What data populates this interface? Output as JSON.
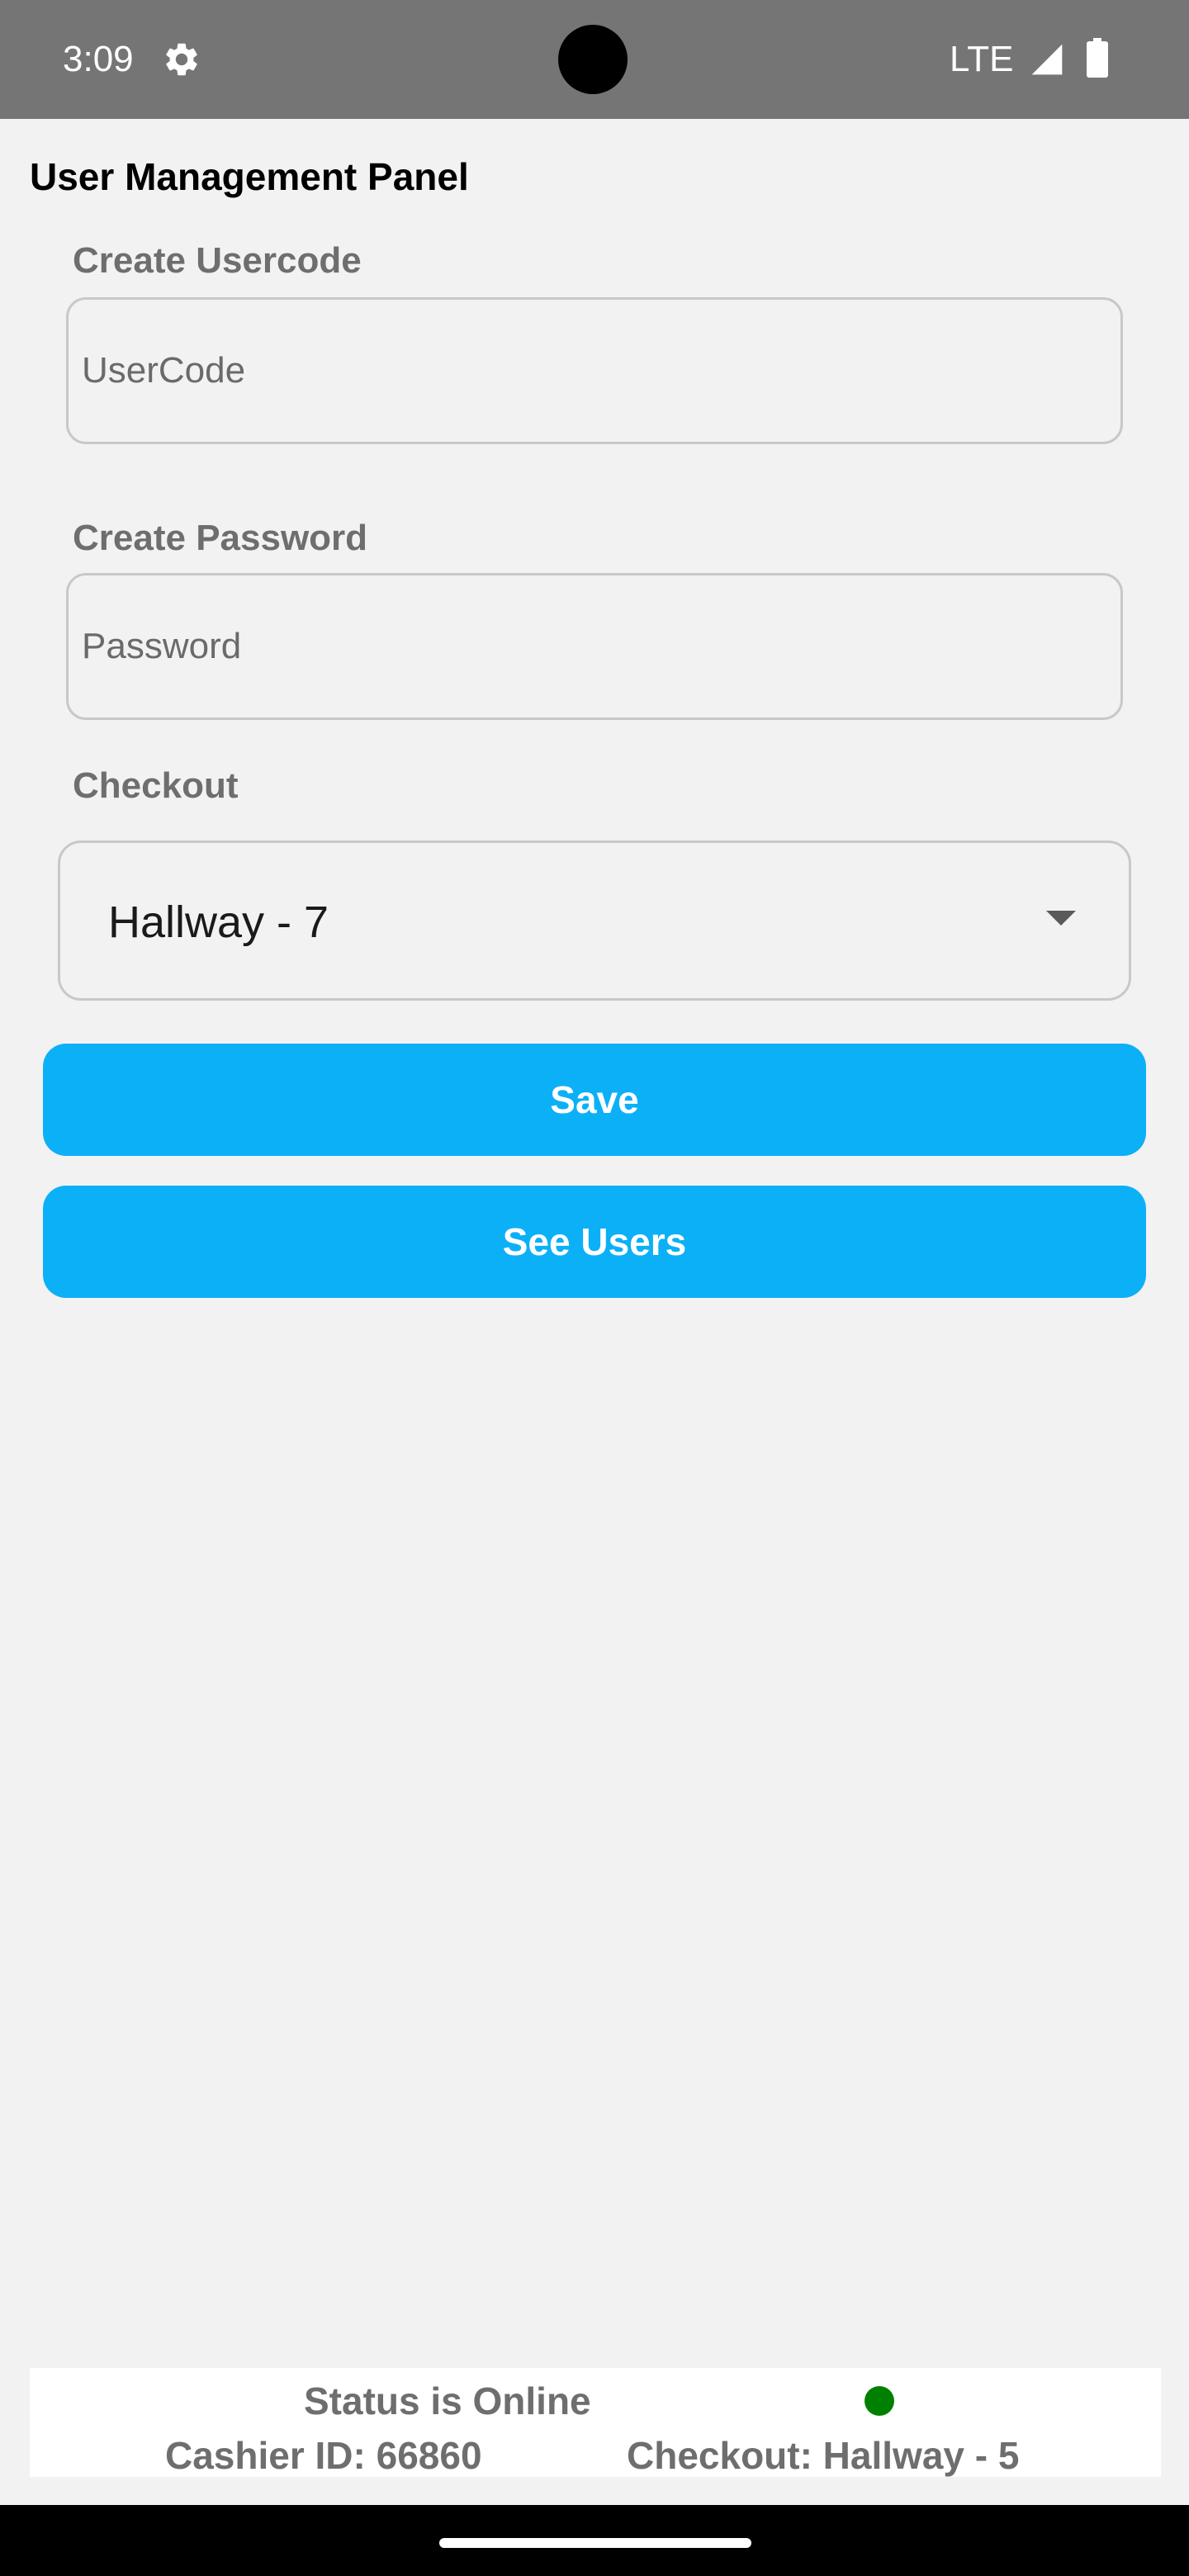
{
  "status_bar": {
    "time": "3:09",
    "settings_icon": "gear-icon",
    "network": "LTE",
    "signal_icon": "signal-icon",
    "battery_icon": "battery-icon"
  },
  "page": {
    "title": "User Management Panel"
  },
  "form": {
    "usercode": {
      "label": "Create Usercode",
      "placeholder": "UserCode",
      "value": ""
    },
    "password": {
      "label": "Create Password",
      "placeholder": "Password",
      "value": ""
    },
    "checkout": {
      "label": "Checkout",
      "selected": "Hallway - 7",
      "caret_icon": "caret-down-icon"
    },
    "save_label": "Save",
    "see_users_label": "See Users"
  },
  "footer": {
    "status_text": "Status is Online",
    "status_color": "#008000",
    "cashier_id": "Cashier ID: 66860",
    "checkout": "Checkout: Hallway - 5"
  },
  "colors": {
    "accent": "#0cb0f7",
    "status_bar": "#757575",
    "background": "#f2f2f2"
  }
}
